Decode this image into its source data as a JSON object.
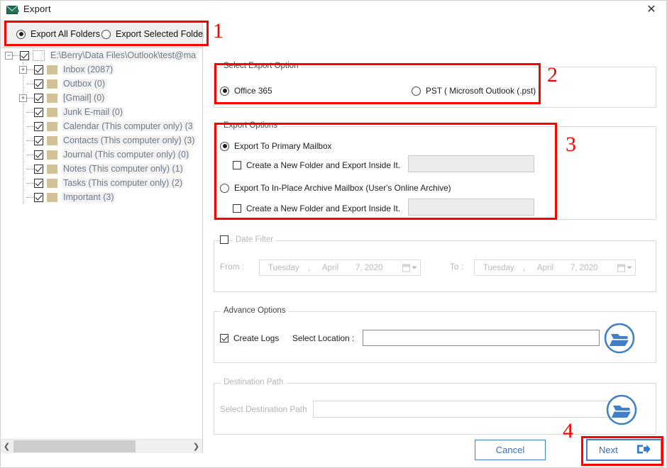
{
  "window": {
    "title": "Export",
    "title_icon": "mail-export-icon",
    "close_label": "✕"
  },
  "left_panel": {
    "mode_options": [
      {
        "label": "Export All Folders",
        "selected": true
      },
      {
        "label": "Export Selected Folders",
        "selected": false
      }
    ],
    "tree": {
      "root": {
        "label": "E:\\Berry\\Data Files\\Outlook\\test@ma",
        "expander": "-",
        "checked": true
      },
      "children": [
        {
          "label": "Inbox (2087)",
          "expander": "+",
          "checked": true
        },
        {
          "label": "Outbox (0)",
          "expander": "",
          "checked": true
        },
        {
          "label": "[Gmail] (0)",
          "expander": "+",
          "checked": true
        },
        {
          "label": "Junk E-mail (0)",
          "expander": "",
          "checked": true
        },
        {
          "label": "Calendar (This computer only) (3",
          "expander": "",
          "checked": true
        },
        {
          "label": "Contacts (This computer only) (3)",
          "expander": "",
          "checked": true
        },
        {
          "label": "Journal (This computer only) (0)",
          "expander": "",
          "checked": true
        },
        {
          "label": "Notes (This computer only) (1)",
          "expander": "",
          "checked": true
        },
        {
          "label": "Tasks (This computer only) (2)",
          "expander": "",
          "checked": true
        },
        {
          "label": "Important (3)",
          "expander": "",
          "checked": true
        }
      ]
    },
    "scrollbar": {
      "left_arrow": "❮",
      "right_arrow": "❯"
    }
  },
  "select_export_option": {
    "title": "Select Export Option",
    "options": [
      {
        "label": "Office 365",
        "selected": true
      },
      {
        "label": "PST ( Microsoft Outlook (.pst) )",
        "selected": false
      }
    ]
  },
  "export_options": {
    "title": "Export Options",
    "primary": {
      "radio_label": "Export To Primary Mailbox",
      "selected": true,
      "checkbox_label": "Create a New Folder and Export Inside It.",
      "checkbox_checked": false,
      "folder_value": ""
    },
    "archive": {
      "radio_label": "Export To In-Place Archive Mailbox (User's Online Archive)",
      "selected": false,
      "checkbox_label": "Create a New Folder and Export Inside It.",
      "checkbox_checked": false,
      "folder_value": ""
    }
  },
  "date_filter": {
    "title": "Date Filter",
    "enabled": false,
    "from_label": "From :",
    "to_label": "To :",
    "from_date": {
      "weekday": "Tuesday",
      "comma": ",",
      "month": "April",
      "day_year": "7, 2020"
    },
    "to_date": {
      "weekday": "Tuesday",
      "comma": ",",
      "month": "April",
      "day_year": "7, 2020"
    }
  },
  "advance_options": {
    "title": "Advance Options",
    "create_logs_label": "Create Logs",
    "create_logs_checked": true,
    "select_location_label": "Select Location :",
    "location_value": "",
    "browse_icon": "folder-open-icon"
  },
  "destination_path": {
    "title": "Destination Path",
    "select_label": "Select Destination Path",
    "path_value": "",
    "browse_icon": "folder-open-icon"
  },
  "footer": {
    "cancel_label": "Cancel",
    "next_label": "Next",
    "next_icon": "arrow-right-export-icon"
  },
  "annotations": [
    {
      "number": "1"
    },
    {
      "number": "2"
    },
    {
      "number": "3"
    },
    {
      "number": "4"
    }
  ],
  "colors": {
    "accent_blue": "#3f7fd0",
    "annotation_red": "#ff0000",
    "tree_text": "#6c7a89",
    "folder_tan": "#d8c9a3"
  }
}
